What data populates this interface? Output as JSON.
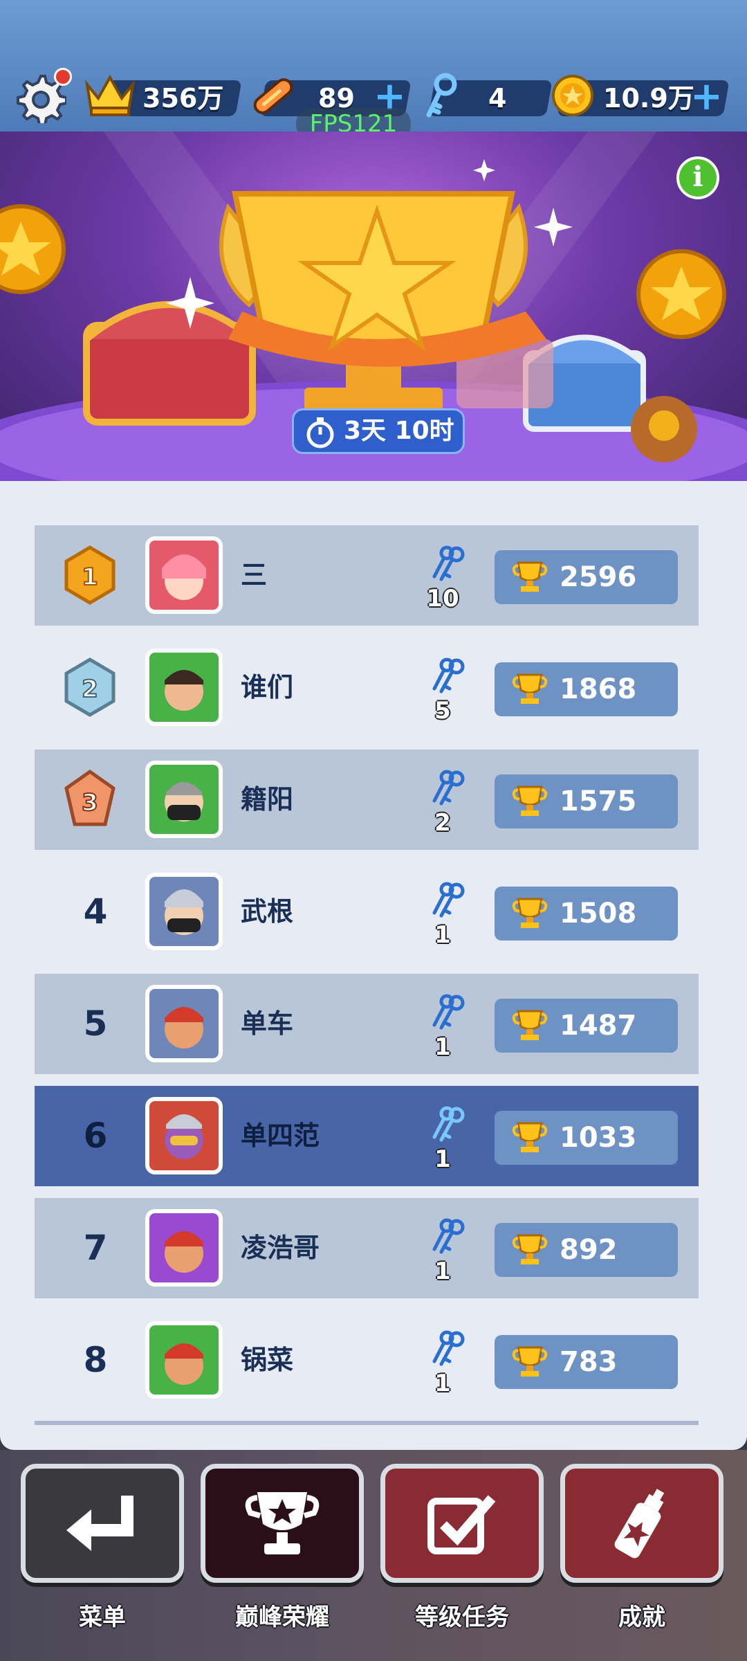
{
  "topbar": {
    "crown_value": "356万",
    "board_value": "89",
    "key_value": "4",
    "coin_value": "10.9万",
    "fps": "FPS121"
  },
  "banner": {
    "timer": "3天 10时",
    "info_label": "i"
  },
  "leaderboard": [
    {
      "rank": "1",
      "name": "三",
      "keys": "10",
      "score": "2596"
    },
    {
      "rank": "2",
      "name": "谁们",
      "keys": "5",
      "score": "1868"
    },
    {
      "rank": "3",
      "name": "籍阳",
      "keys": "2",
      "score": "1575"
    },
    {
      "rank": "4",
      "name": "武根",
      "keys": "1",
      "score": "1508"
    },
    {
      "rank": "5",
      "name": "单车",
      "keys": "1",
      "score": "1487"
    },
    {
      "rank": "6",
      "name": "单四范",
      "keys": "1",
      "score": "1033"
    },
    {
      "rank": "7",
      "name": "凌浩哥",
      "keys": "1",
      "score": "892"
    },
    {
      "rank": "8",
      "name": "锅菜",
      "keys": "1",
      "score": "783"
    }
  ],
  "nav": {
    "menu": "菜单",
    "peak_honor": "巅峰荣耀",
    "level_tasks": "等级任务",
    "achievements": "成就"
  },
  "colors": {
    "highlight_row": "#4865a8",
    "alt_row": "#b9c6d8",
    "score_pill": "#6f92c4",
    "nav_menu": "#3a3a3e",
    "nav_peak": "#2a0f18",
    "nav_tasks": "#8a2b34",
    "nav_achieve": "#8a2b34"
  }
}
